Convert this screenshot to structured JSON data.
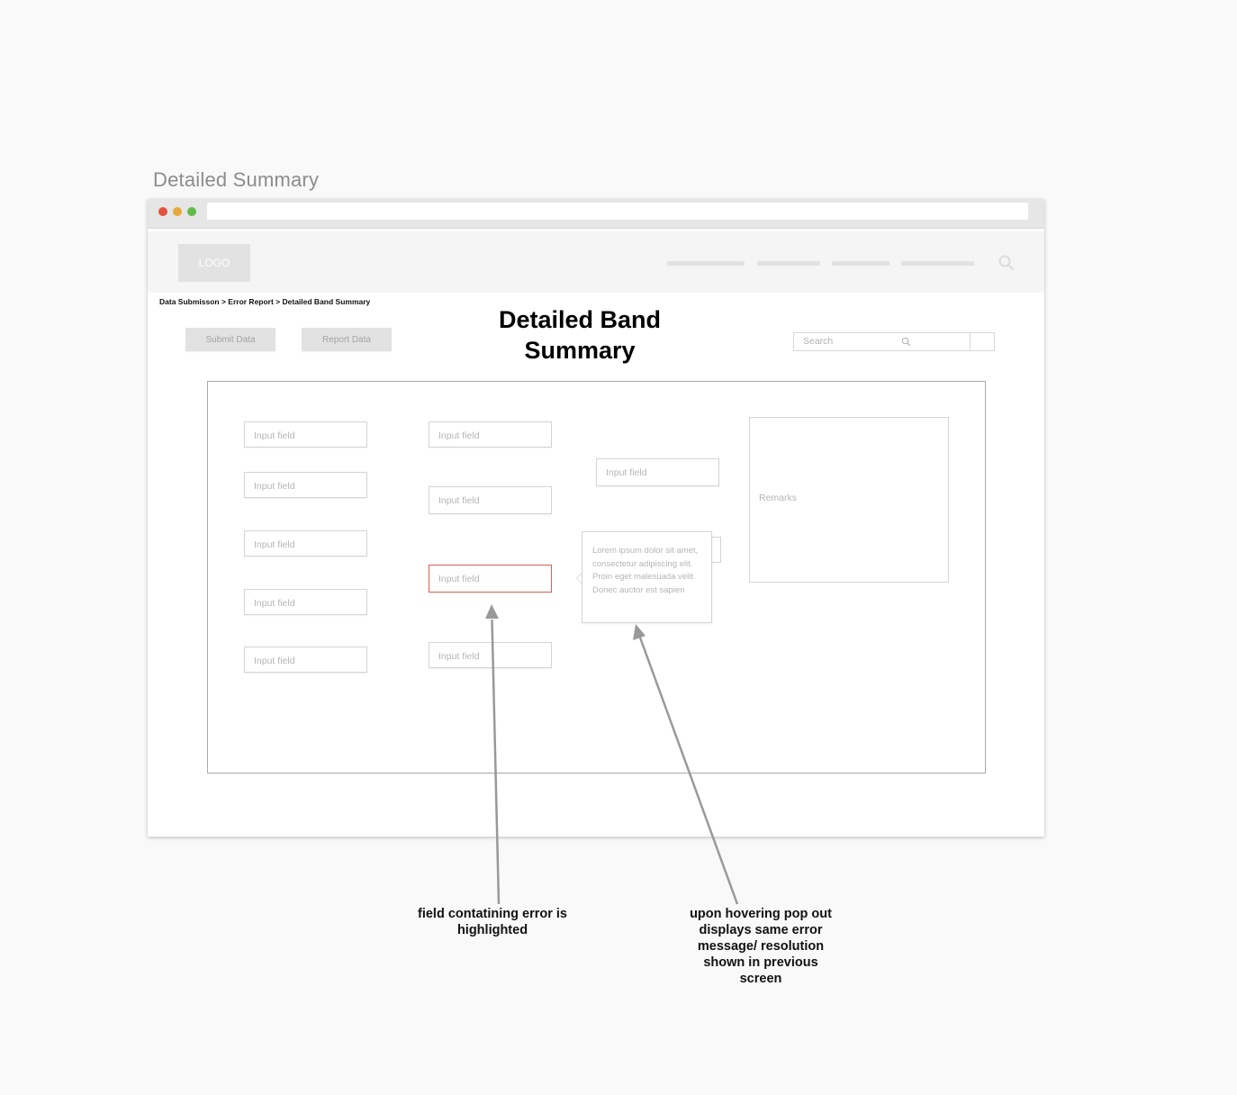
{
  "artboard": {
    "title": "Detailed Summary"
  },
  "header": {
    "logo_label": "LOGO",
    "search_icon": "search-icon"
  },
  "breadcrumb": "Data Submisson > Error Report > Detailed Band Summary",
  "page": {
    "title": "Detailed Band Summary"
  },
  "toolbar": {
    "submit_label": "Submit Data",
    "report_label": "Report Data",
    "search_placeholder": "Search"
  },
  "form": {
    "column1": [
      "Input field",
      "Input field",
      "Input field",
      "Input field",
      "Input field"
    ],
    "column2": [
      "Input field",
      "Input field",
      "Input field",
      "Input field"
    ],
    "column3": [
      "Input field"
    ],
    "remarks_placeholder": "Remarks"
  },
  "popover": {
    "text": "Lorem ipsum dolor sit amet, consectetur adipiscing elit. Proin eget malesuada velit. Donec auctor est sapien"
  },
  "annotations": {
    "error_note": "field contatining error is highlighted",
    "hover_note": "upon hovering pop out displays same error message/ resolution shown in previous screen"
  },
  "colors": {
    "error_border": "#e25b57",
    "dot_red": "#e0533d",
    "dot_yellow": "#e8a93b",
    "dot_green": "#63bb4a"
  }
}
